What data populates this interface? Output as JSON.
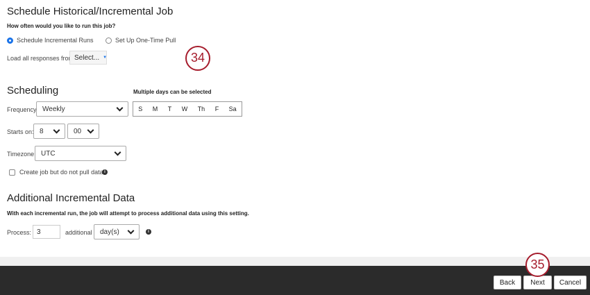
{
  "schedule": {
    "title": "Schedule Historical/Incremental Job",
    "question": "How often would you like to run this job?",
    "option_incremental": "Schedule Incremental Runs",
    "option_onetime": "Set Up One-Time Pull",
    "load_label": "Load all responses from:",
    "load_value": "Select..."
  },
  "scheduling": {
    "title": "Scheduling",
    "days_hint": "Multiple days can be selected",
    "frequency_label": "Frequency:",
    "frequency_value": "Weekly",
    "days": [
      "S",
      "M",
      "T",
      "W",
      "Th",
      "F",
      "Sa"
    ],
    "starts_label": "Starts on:",
    "hour": "8",
    "minute": "00",
    "timezone_label": "Timezone:",
    "timezone_value": "UTC",
    "create_only_label": "Create job but do not pull data"
  },
  "additional": {
    "title": "Additional Incremental Data",
    "description": "With each incremental run, the job will attempt to process additional data using this setting.",
    "process_label": "Process:",
    "process_value": "3",
    "additional_label": "additional",
    "unit_value": "day(s)"
  },
  "annotations": {
    "step_a": "34",
    "step_b": "35"
  },
  "footer": {
    "back": "Back",
    "next": "Next",
    "cancel": "Cancel"
  }
}
